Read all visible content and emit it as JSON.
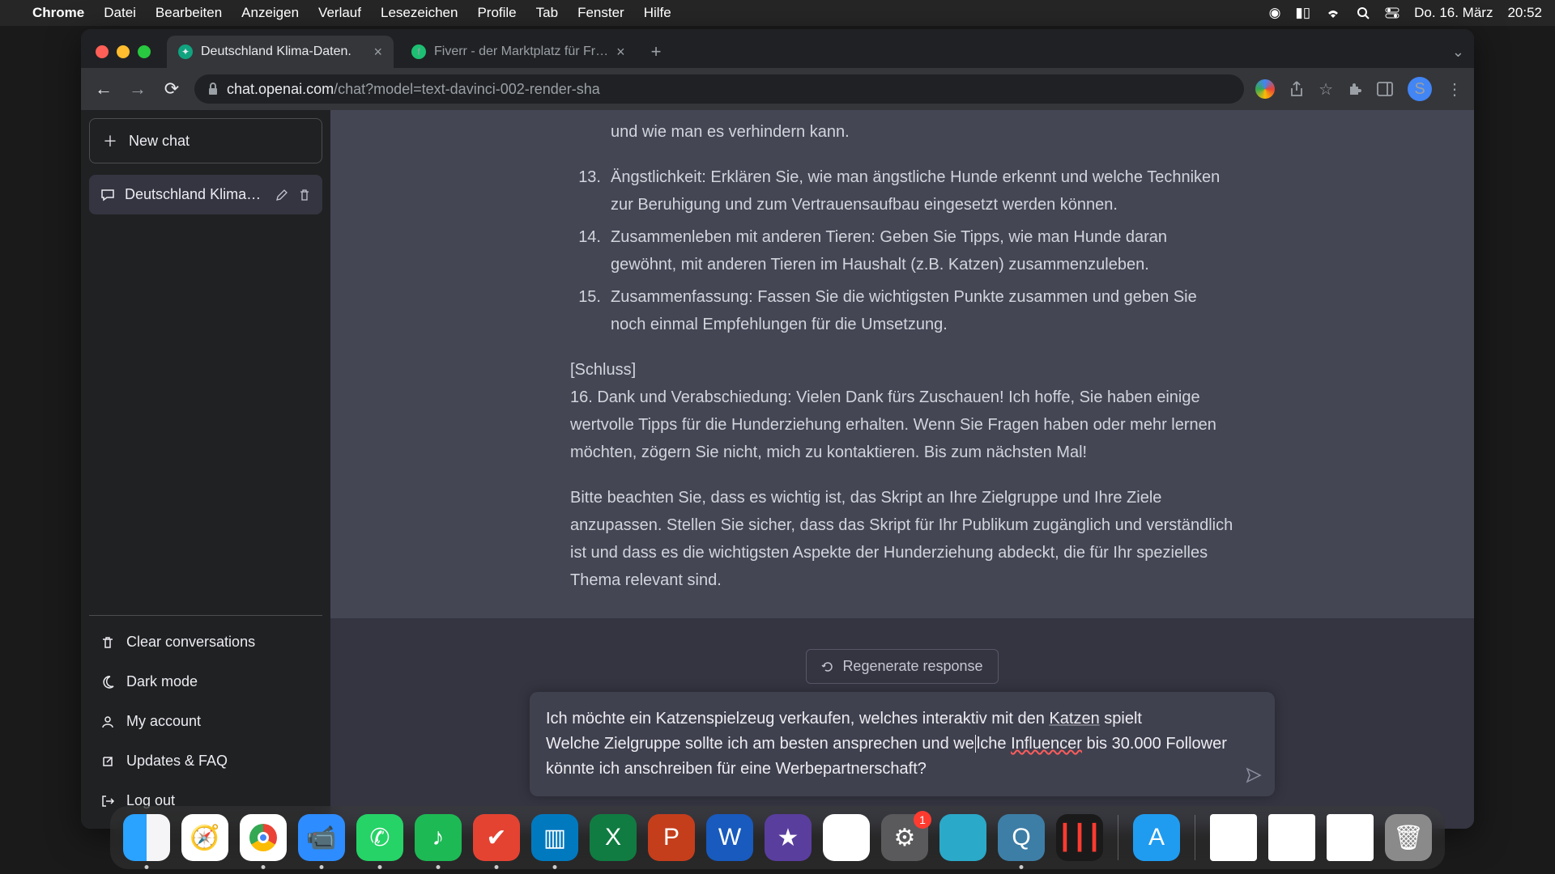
{
  "menubar": {
    "app": "Chrome",
    "menus": [
      "Datei",
      "Bearbeiten",
      "Anzeigen",
      "Verlauf",
      "Lesezeichen",
      "Profile",
      "Tab",
      "Fenster",
      "Hilfe"
    ],
    "date": "Do. 16. März",
    "time": "20:52"
  },
  "tabs": {
    "active": {
      "title": "Deutschland Klima-Daten."
    },
    "inactive": {
      "title": "Fiverr - der Marktplatz für Fr…"
    }
  },
  "address": {
    "host": "chat.openai.com",
    "path": "/chat?model=text-davinci-002-render-sha"
  },
  "sidebar": {
    "new_chat": "New chat",
    "conversation": "Deutschland Klima-Da",
    "footer": {
      "clear": "Clear conversations",
      "dark": "Dark mode",
      "account": "My account",
      "updates": "Updates & FAQ",
      "logout": "Log out"
    }
  },
  "content": {
    "line_partial": "und wie man es verhindern kann.",
    "items": [
      {
        "n": "13.",
        "text": "Ängstlichkeit: Erklären Sie, wie man ängstliche Hunde erkennt und welche Techniken zur Beruhigung und zum Vertrauensaufbau eingesetzt werden können."
      },
      {
        "n": "14.",
        "text": "Zusammenleben mit anderen Tieren: Geben Sie Tipps, wie man Hunde daran gewöhnt, mit anderen Tieren im Haushalt (z.B. Katzen) zusammenzuleben."
      },
      {
        "n": "15.",
        "text": "Zusammenfassung: Fassen Sie die wichtigsten Punkte zusammen und geben Sie noch einmal Empfehlungen für die Umsetzung."
      }
    ],
    "schluss_heading": "[Schluss]",
    "schluss_text": "16. Dank und Verabschiedung: Vielen Dank fürs Zuschauen! Ich hoffe, Sie haben einige wertvolle Tipps für die Hunderziehung erhalten. Wenn Sie Fragen haben oder mehr lernen möchten, zögern Sie nicht, mich zu kontaktieren. Bis zum nächsten Mal!",
    "note": "Bitte beachten Sie, dass es wichtig ist, das Skript an Ihre Zielgruppe und Ihre Ziele anzupassen. Stellen Sie sicher, dass das Skript für Ihr Publikum zugänglich und verständlich ist und dass es die wichtigsten Aspekte der Hunderziehung abdeckt, die für Ihr spezielles Thema relevant sind."
  },
  "regen": "Regenerate response",
  "input": {
    "l1a": "Ich möchte ein Katzenspielzeug verkaufen, welches interaktiv mit den ",
    "l1b": "Katzen",
    "l1c": " spielt",
    "l2a": "Welche Zielgruppe sollte ich am besten ansprechen und we",
    "l2b": "lche ",
    "l2c": "Influencer",
    "l2d": " bis 30.000 Follower könnte ich anschreiben für eine Werbepartnerschaft?"
  },
  "profile_initial": "S",
  "settings_badge": "1"
}
